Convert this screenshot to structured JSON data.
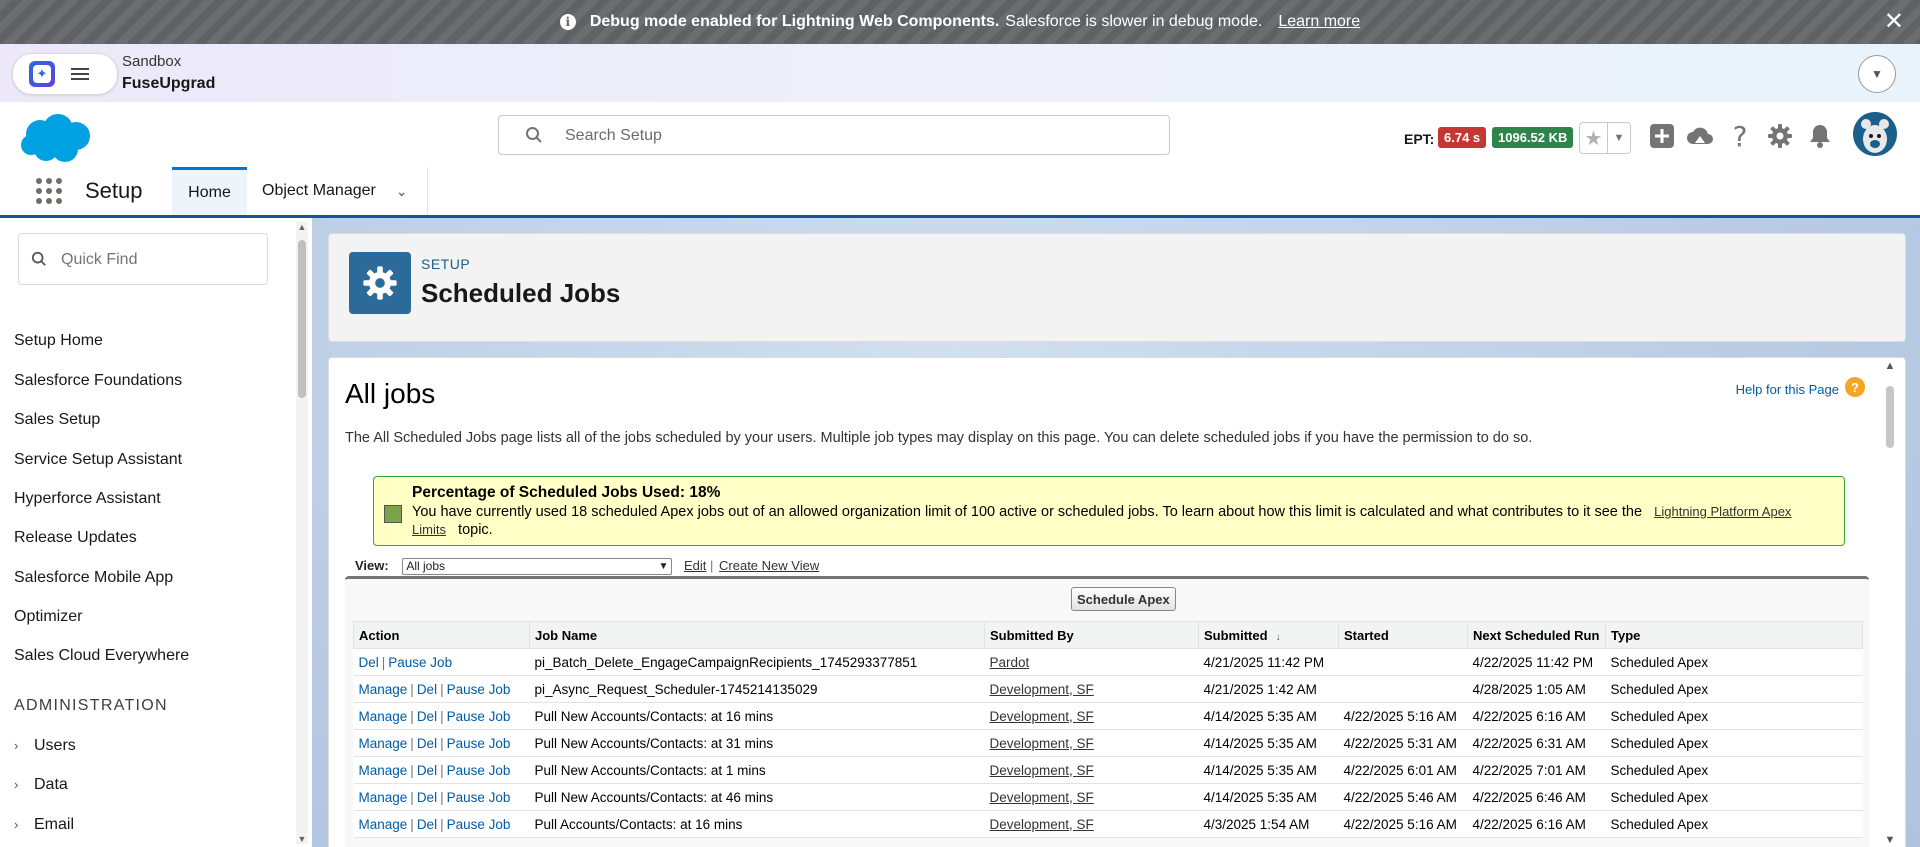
{
  "debug_banner": {
    "bold": "Debug mode enabled for Lightning Web Components.",
    "text": "Salesforce is slower in debug mode.",
    "link": "Learn more",
    "close": "✕"
  },
  "sandbox": {
    "label": "Sandbox",
    "org": "FuseUpgrad"
  },
  "header": {
    "search_placeholder": "Search Setup",
    "ept_label": "EPT:",
    "ept_time": "6.74 s",
    "ept_size": "1096.52 KB",
    "colors": {
      "ept_time": "#c23934",
      "ept_size": "#2e844a",
      "brand": "#0176d3"
    }
  },
  "nav": {
    "app_name": "Setup",
    "tabs": [
      {
        "label": "Home"
      },
      {
        "label": "Object Manager"
      }
    ]
  },
  "sidebar": {
    "quick_find_placeholder": "Quick Find",
    "items": [
      {
        "label": "Setup Home"
      },
      {
        "label": "Salesforce Foundations"
      },
      {
        "label": "Sales Setup"
      },
      {
        "label": "Service Setup Assistant"
      },
      {
        "label": "Hyperforce Assistant"
      },
      {
        "label": "Release Updates"
      },
      {
        "label": "Salesforce Mobile App"
      },
      {
        "label": "Optimizer"
      },
      {
        "label": "Sales Cloud Everywhere"
      }
    ],
    "section": "ADMINISTRATION",
    "expandables": [
      {
        "label": "Users"
      },
      {
        "label": "Data"
      },
      {
        "label": "Email"
      }
    ]
  },
  "page_header": {
    "crumb": "SETUP",
    "title": "Scheduled Jobs"
  },
  "content": {
    "title": "All jobs",
    "help_link": "Help for this Page",
    "intro": "The All Scheduled Jobs page lists all of the jobs scheduled by your users. Multiple job types may display on this page. You can delete scheduled jobs if you have the permission to do so.",
    "usage_title": "Percentage of Scheduled Jobs Used: 18%",
    "usage_text": "You have currently used 18 scheduled Apex jobs out of an allowed organization limit of 100 active or scheduled jobs. To learn about how this limit is calculated and what contributes to it see the",
    "usage_link": "Lightning Platform Apex Limits",
    "usage_suffix": "topic.",
    "view_label": "View:",
    "view_value": "All jobs",
    "edit_link": "Edit",
    "create_view_link": "Create New View",
    "schedule_button": "Schedule Apex"
  },
  "table": {
    "columns": [
      "Action",
      "Job Name",
      "Submitted By",
      "Submitted",
      "Started",
      "Next Scheduled Run",
      "Type"
    ],
    "rows": [
      {
        "actions": [
          "Del",
          "Pause Job"
        ],
        "job": "pi_Batch_Delete_EngageCampaignRecipients_1745293377851",
        "by": "Pardot",
        "submitted": "4/21/2025 11:42 PM",
        "started": "",
        "next": "4/22/2025 11:42 PM",
        "type": "Scheduled Apex"
      },
      {
        "actions": [
          "Manage",
          "Del",
          "Pause Job"
        ],
        "job": "pi_Async_Request_Scheduler-1745214135029",
        "by": "Development, SF",
        "submitted": "4/21/2025 1:42 AM",
        "started": "",
        "next": "4/28/2025 1:05 AM",
        "type": "Scheduled Apex"
      },
      {
        "actions": [
          "Manage",
          "Del",
          "Pause Job"
        ],
        "job": "Pull New Accounts/Contacts: at 16 mins",
        "by": "Development, SF",
        "submitted": "4/14/2025 5:35 AM",
        "started": "4/22/2025 5:16 AM",
        "next": "4/22/2025 6:16 AM",
        "type": "Scheduled Apex"
      },
      {
        "actions": [
          "Manage",
          "Del",
          "Pause Job"
        ],
        "job": "Pull New Accounts/Contacts: at 31 mins",
        "by": "Development, SF",
        "submitted": "4/14/2025 5:35 AM",
        "started": "4/22/2025 5:31 AM",
        "next": "4/22/2025 6:31 AM",
        "type": "Scheduled Apex"
      },
      {
        "actions": [
          "Manage",
          "Del",
          "Pause Job"
        ],
        "job": "Pull New Accounts/Contacts: at 1 mins",
        "by": "Development, SF",
        "submitted": "4/14/2025 5:35 AM",
        "started": "4/22/2025 6:01 AM",
        "next": "4/22/2025 7:01 AM",
        "type": "Scheduled Apex"
      },
      {
        "actions": [
          "Manage",
          "Del",
          "Pause Job"
        ],
        "job": "Pull New Accounts/Contacts: at 46 mins",
        "by": "Development, SF",
        "submitted": "4/14/2025 5:35 AM",
        "started": "4/22/2025 5:46 AM",
        "next": "4/22/2025 6:46 AM",
        "type": "Scheduled Apex"
      },
      {
        "actions": [
          "Manage",
          "Del",
          "Pause Job"
        ],
        "job": "Pull Accounts/Contacts: at 16 mins",
        "by": "Development, SF",
        "submitted": "4/3/2025 1:54 AM",
        "started": "4/22/2025 5:16 AM",
        "next": "4/22/2025 6:16 AM",
        "type": "Scheduled Apex"
      }
    ]
  }
}
